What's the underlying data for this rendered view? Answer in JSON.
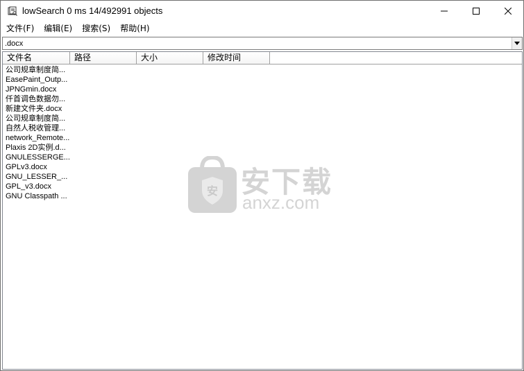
{
  "window": {
    "title": "lowSearch 0 ms 14/492991 objects"
  },
  "menu": {
    "items": [
      "文件(F)",
      "编辑(E)",
      "搜索(S)",
      "帮助(H)"
    ]
  },
  "search": {
    "value": ".docx"
  },
  "list": {
    "columns": [
      "文件名",
      "路径",
      "大小",
      "修改时间"
    ],
    "rows": [
      "公司规章制度简...",
      "EasePaint_Outp...",
      "JPNGmin.docx",
      "仟首调色数据勿...",
      "新建文件夹.docx",
      "公司规章制度简...",
      "自然人税收管理...",
      "network_Remote...",
      "Plaxis 2D实例.d...",
      "GNULESSERGE...",
      "GPLv3.docx",
      "GNU_LESSER_...",
      "GPL_v3.docx",
      "GNU Classpath ..."
    ]
  },
  "watermark": {
    "cn": "安下载",
    "en": "anxz.com"
  },
  "colors": {
    "watermark": "#d0d0d0",
    "border": "#828790"
  }
}
